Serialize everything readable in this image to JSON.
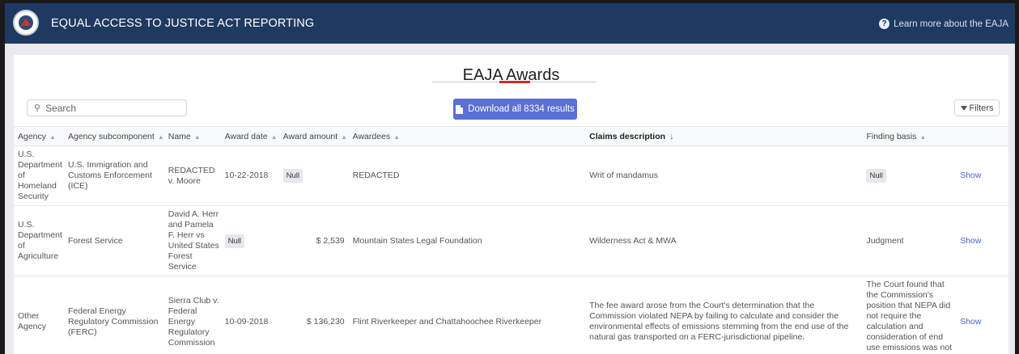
{
  "header": {
    "title": "EQUAL ACCESS TO JUSTICE ACT REPORTING",
    "learn_more": "Learn more about the EAJA"
  },
  "page": {
    "title": "EAJA Awards",
    "search_placeholder": "Search",
    "download_label": "Download all 8334 results",
    "filters_label": "Filters"
  },
  "table": {
    "columns": [
      "Agency",
      "Agency subcomponent",
      "Name",
      "Award date",
      "Award amount",
      "Awardees",
      "Claims description",
      "Finding basis"
    ],
    "show_label": "Show",
    "rows": [
      {
        "agency": "U.S. Department of Homeland Security",
        "subcomponent": "U.S. Immigration and Customs Enforcement (ICE)",
        "name": "REDACTED v. Moore",
        "award_date": "10-22-2018",
        "award_amount": "",
        "awardees": "REDACTED",
        "claims": "Writ of mandamus",
        "finding_basis": "",
        "date_null": false,
        "amount_null": true,
        "finding_null": true,
        "null_label": "Null"
      },
      {
        "agency": "U.S. Department of Agriculture",
        "subcomponent": "Forest Service",
        "name": "David A. Herr and Pamela F. Herr vs United States Forest Service",
        "award_date": "",
        "award_amount": "$ 2,539",
        "awardees": "Mountain States Legal Foundation",
        "claims": "Wilderness Act & MWA",
        "finding_basis": "Judgment",
        "date_null": true,
        "amount_null": false,
        "finding_null": false,
        "null_label": "Null"
      },
      {
        "agency": "Other Agency",
        "subcomponent": "Federal Energy Regulatory Commission (FERC)",
        "name": "Sierra Club v. Federal Energy Regulatory Commission",
        "award_date": "10-09-2018",
        "award_amount": "$ 136,230",
        "awardees": "Flint Riverkeeper and Chattahoochee Riverkeeper",
        "claims": "The fee award arose from the Court's determination that the Commission violated NEPA by failing to calculate and consider the environmental effects of emissions stemming from the end use of the natural gas transported on a FERC-jurisdictional pipeline.",
        "finding_basis": "The Court found that the Commission's position that NEPA did not require the calculation and consideration of end use emissions was not substantially justified.",
        "date_null": false,
        "amount_null": false,
        "finding_null": false,
        "null_label": "Null"
      }
    ]
  },
  "colors": {
    "header_bg": "#1f3a60",
    "accent": "#5b6fd4",
    "title_underline": "#d22a2a",
    "link": "#4a63d0"
  }
}
